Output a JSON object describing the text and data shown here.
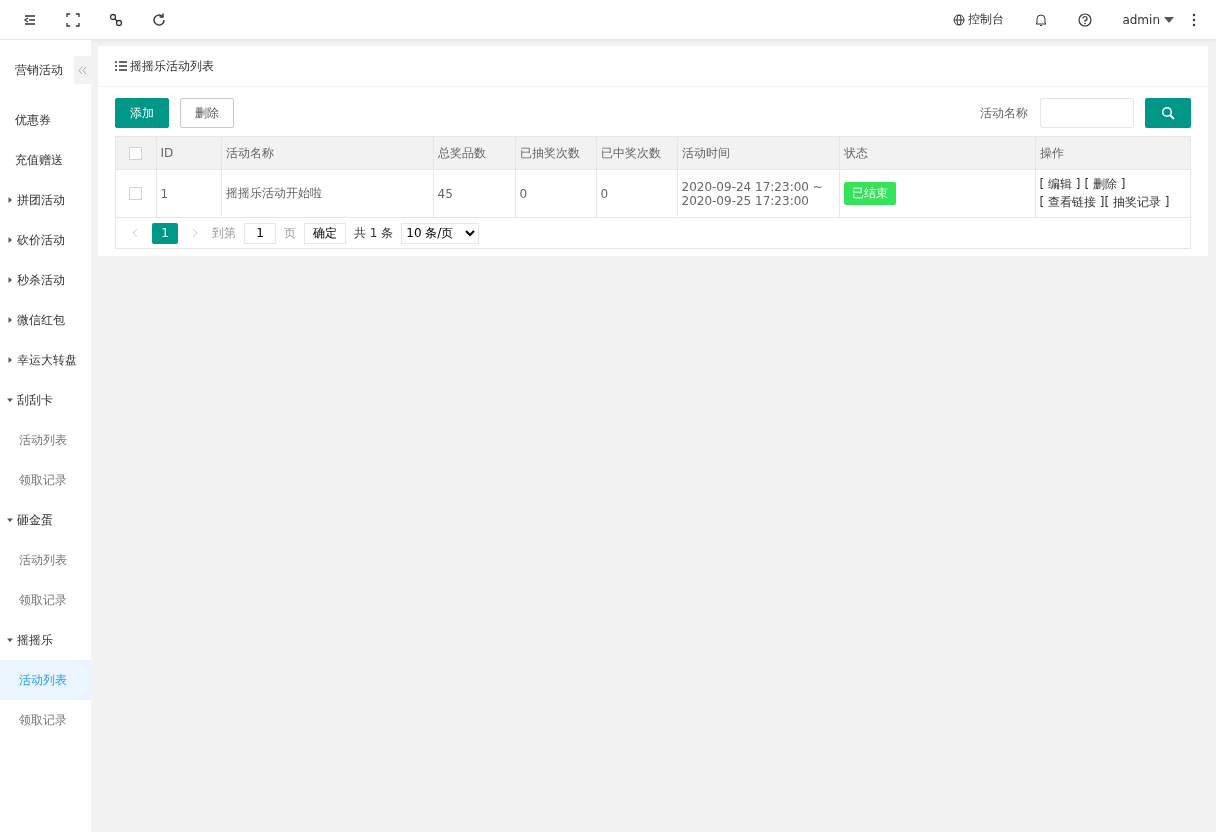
{
  "topbar": {
    "console": "控制台",
    "user": "admin"
  },
  "sidebar": {
    "title": "营销活动",
    "items": [
      {
        "label": "优惠券",
        "kind": "link",
        "selected": false
      },
      {
        "label": "充值赠送",
        "kind": "link",
        "selected": false
      },
      {
        "label": "拼团活动",
        "kind": "group",
        "expanded": false,
        "selected": false
      },
      {
        "label": "砍价活动",
        "kind": "group",
        "expanded": false,
        "selected": false
      },
      {
        "label": "秒杀活动",
        "kind": "group",
        "expanded": false,
        "selected": false
      },
      {
        "label": "微信红包",
        "kind": "group",
        "expanded": false,
        "selected": false
      },
      {
        "label": "幸运大转盘",
        "kind": "group",
        "expanded": false,
        "selected": false
      },
      {
        "label": "刮刮卡",
        "kind": "group",
        "expanded": true,
        "selected": false,
        "children": [
          {
            "label": "活动列表",
            "selected": false
          },
          {
            "label": "领取记录",
            "selected": false
          }
        ]
      },
      {
        "label": "砸金蛋",
        "kind": "group",
        "expanded": true,
        "selected": false,
        "children": [
          {
            "label": "活动列表",
            "selected": false
          },
          {
            "label": "领取记录",
            "selected": false
          }
        ]
      },
      {
        "label": "摇摇乐",
        "kind": "group",
        "expanded": true,
        "selected": false,
        "children": [
          {
            "label": "活动列表",
            "selected": true
          },
          {
            "label": "领取记录",
            "selected": false
          }
        ]
      }
    ]
  },
  "card": {
    "title": "摇摇乐活动列表",
    "buttons": [
      {
        "label": "添加",
        "kind": "primary"
      },
      {
        "label": "删除",
        "kind": "plain"
      }
    ],
    "search": {
      "label": "活动名称"
    }
  },
  "table": {
    "all_checked": false,
    "columns": [
      "ID",
      "活动名称",
      "总奖品数",
      "已抽奖次数",
      "已中奖次数",
      "活动时间",
      "状态",
      "操作"
    ],
    "rows": [
      {
        "checked": false,
        "id": "1",
        "name": "摇摇乐活动开始啦",
        "total": "45",
        "drawn": "0",
        "won": "0",
        "time": [
          "2020-09-24 17:23:00 ~",
          "2020-09-25 17:23:00"
        ],
        "status": {
          "text": "已结束",
          "kind": "ended"
        },
        "actions": [
          [
            "[ 编辑 ]",
            "[ 删除 ]"
          ],
          [
            "[ 查看链接 ]",
            "[ 抽奖记录 ]"
          ]
        ]
      }
    ]
  },
  "pagination": {
    "pages": [
      {
        "label": "1",
        "selected": true
      }
    ],
    "goto": "到第",
    "page_value": "1",
    "page_unit": "页",
    "confirm": "确定",
    "total": "共 1 条",
    "page_size": "10 条/页"
  }
}
